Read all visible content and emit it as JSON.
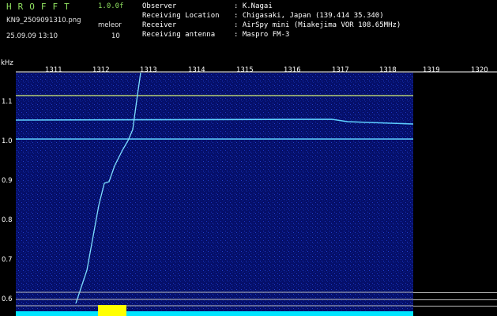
{
  "app": {
    "title": "HROFFT",
    "version": "1.0.0f"
  },
  "file": {
    "name": "KN9_2509091310.png",
    "mode": "meleor",
    "count": "10",
    "datetime": "25.09.09 13:10"
  },
  "info": {
    "observer_label": "Observer",
    "observer_value": ": K.Nagai",
    "location_label": "Receiving Location",
    "location_value": ": Chigasaki, Japan (139.414 35.340)",
    "receiver_label": "Receiver",
    "receiver_value": ": AirSpy mini (Miakejima VOR 108.65MHz)",
    "antenna_label": "Receiving antenna",
    "antenna_value": ": Maspro FM-3"
  },
  "axis": {
    "y_unit": "kHz",
    "y_ticks": [
      "1.1",
      "1.0",
      "0.9",
      "0.8",
      "0.7",
      "0.6"
    ],
    "x_ticks": [
      "1311",
      "1312",
      "1313",
      "1314",
      "1315",
      "1316",
      "1317",
      "1318",
      "1319",
      "1320"
    ]
  },
  "colors": {
    "bg": "#000000",
    "spectrum": "#0a1a8c",
    "carrier": "#5fd0ff",
    "ref": "#d6f070",
    "noise": "#00e5ff",
    "burst": "#ffff00"
  }
}
